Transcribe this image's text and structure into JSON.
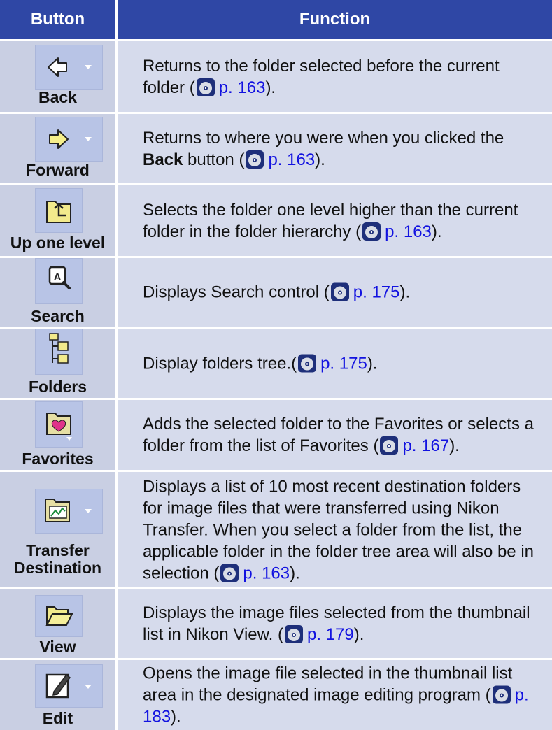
{
  "headers": {
    "button": "Button",
    "function": "Function"
  },
  "rows": [
    {
      "label": "Back",
      "icon": "back-arrow-icon",
      "text_before": "Returns to the folder selected before the current folder (",
      "ref": "p. 163",
      "text_after": ")."
    },
    {
      "label": "Forward",
      "icon": "forward-arrow-icon",
      "text_before": "Returns to where you were when you clicked the ",
      "bold": "Back",
      "text_mid": " button (",
      "ref": "p. 163",
      "text_after": ")."
    },
    {
      "label": "Up one level",
      "icon": "up-folder-icon",
      "text_before": "Selects the folder one level higher than the current folder in the folder hierarchy (",
      "ref": "p. 163",
      "text_after": ")."
    },
    {
      "label": "Search",
      "icon": "search-icon",
      "text_before": "Displays Search control (",
      "ref": "p. 175",
      "text_after": ")."
    },
    {
      "label": "Folders",
      "icon": "folder-tree-icon",
      "text_before": "Display folders tree.(",
      "ref": "p. 175",
      "text_after": ")."
    },
    {
      "label": "Favorites",
      "icon": "favorites-icon",
      "text_before": "Adds the selected folder to the Favorites or selects a folder from the list of Favorites (",
      "ref": "p. 167",
      "text_after": ")."
    },
    {
      "label_line1": "Transfer",
      "label_line2": "Destination",
      "icon": "transfer-destination-icon",
      "text_before": "Displays a list of 10 most recent destination folders for image files that were transferred using Nikon Transfer. When you select a folder from the list, the applicable folder in the folder tree area will also be in selection (",
      "ref": "p. 163",
      "text_after": ")."
    },
    {
      "label": "View",
      "icon": "open-folder-icon",
      "text_before": "Displays the image files selected from the thumbnail list in Nikon View. (",
      "ref": "p. 179",
      "text_after": ")."
    },
    {
      "label": "Edit",
      "icon": "edit-icon",
      "text_before": "Opens the image file selected in the thumbnail list area in the designated image editing program (",
      "ref": "p. 183",
      "text_after": ")."
    }
  ],
  "colors": {
    "header_bg": "#2f47a5",
    "button_cell_bg": "#c9cfe3",
    "function_cell_bg": "#d6dbec",
    "link": "#1212e0"
  }
}
